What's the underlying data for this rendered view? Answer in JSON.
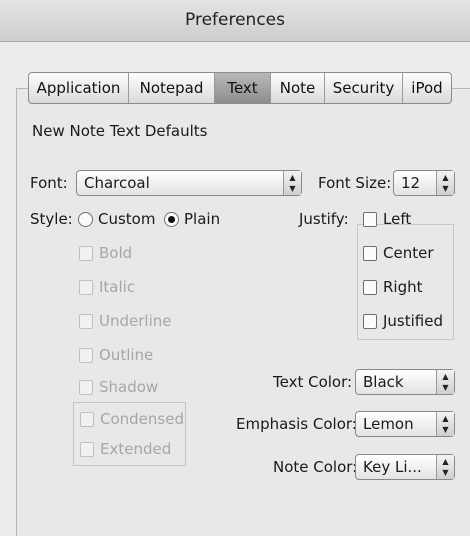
{
  "window": {
    "title": "Preferences"
  },
  "tabs": [
    {
      "label": "Application",
      "selected": false
    },
    {
      "label": "Notepad",
      "selected": false
    },
    {
      "label": "Text",
      "selected": true
    },
    {
      "label": "Note",
      "selected": false
    },
    {
      "label": "Security",
      "selected": false
    },
    {
      "label": "iPod",
      "selected": false
    }
  ],
  "section_title": "New Note Text Defaults",
  "font": {
    "label": "Font:",
    "value": "Charcoal"
  },
  "font_size": {
    "label": "Font Size:",
    "value": "12"
  },
  "style": {
    "label": "Style:",
    "radio_custom": "Custom",
    "radio_plain": "Plain",
    "selected": "Plain",
    "options": [
      "Bold",
      "Italic",
      "Underline",
      "Outline",
      "Shadow"
    ],
    "width_options": [
      "Condensed",
      "Extended"
    ]
  },
  "justify": {
    "label": "Justify:",
    "options": [
      "Left",
      "Center",
      "Right",
      "Justified"
    ]
  },
  "text_color": {
    "label": "Text Color:",
    "value": "Black"
  },
  "emphasis_color": {
    "label": "Emphasis Color:",
    "value": "Lemon"
  },
  "note_color": {
    "label": "Note Color:",
    "value": "Key Li..."
  },
  "icons": {
    "popup_arrows": "up-down-arrows-icon",
    "radio": "radio-button",
    "checkbox": "checkbox"
  }
}
